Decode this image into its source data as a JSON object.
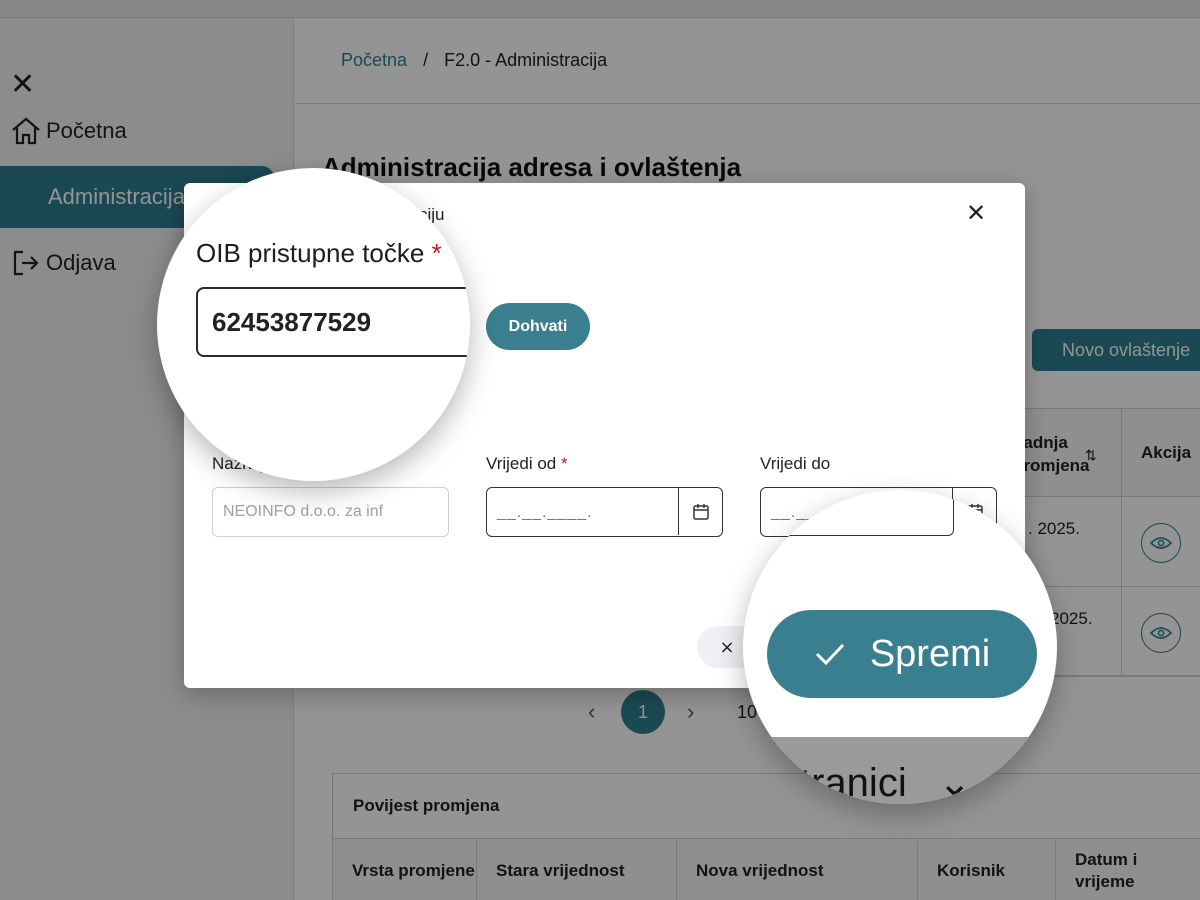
{
  "sidebar": {
    "items": [
      {
        "label": "Početna",
        "icon": "home-icon"
      },
      {
        "label": "Administracija",
        "active": true
      },
      {
        "label": "Odjava",
        "icon": "logout-icon"
      }
    ]
  },
  "breadcrumb": {
    "home": "Početna",
    "separator": "/",
    "current": "F2.0 - Administracija"
  },
  "page": {
    "title": "Administracija adresa i ovlaštenja"
  },
  "toolbar": {
    "new_authorization_label": "Novo ovlaštenje"
  },
  "table": {
    "headers": {
      "last_change": "Zadnja\npromjena",
      "action": "Akcija"
    },
    "rows": [
      {
        "date_fragment": ". 2025."
      },
      {
        "date_fragment": "2025."
      }
    ]
  },
  "pagination": {
    "current_page": "1",
    "page_size": "10"
  },
  "page_size_label_fragment": "tranici",
  "history": {
    "title": "Povijest promjena",
    "columns": [
      "Vrsta promjene",
      "Stara vrijednost",
      "Nova vrijednost",
      "Korisnik",
      "Datum i vrijeme"
    ]
  },
  "modal": {
    "title_fragment": "alizaciju",
    "oib_label": "OIB pristupne točke",
    "oib_value": "62453877529",
    "fetch_label": "Dohvati",
    "name_label": "Naziv pristupne točke",
    "name_value": "NEOINFO d.o.o. za inf",
    "valid_from_label": "Vrijedi od",
    "valid_from_placeholder": "__.__.____.",
    "valid_to_label": "Vrijedi do",
    "valid_to_placeholder": "__.__.____.",
    "required_mark": "*",
    "cancel_label": "×",
    "save_label": "Spremi"
  },
  "colors": {
    "accent": "#2f7f8f",
    "required": "#c0161e"
  }
}
